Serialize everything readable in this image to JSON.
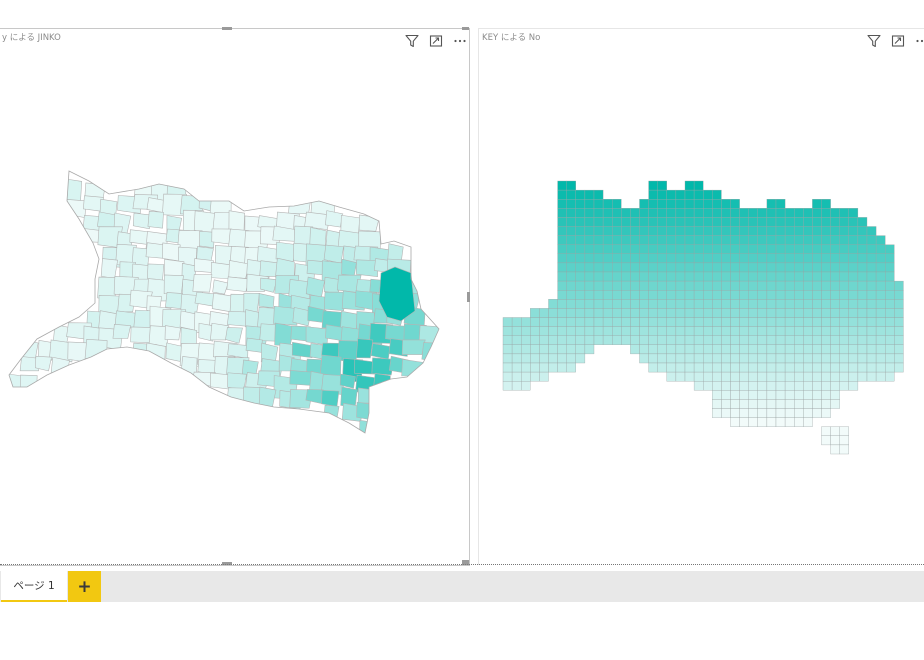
{
  "report": {
    "visuals": [
      {
        "title": "y による JINKO",
        "kind": "filled-map"
      },
      {
        "title": "KEY による No",
        "kind": "grid-map"
      }
    ],
    "visual_header_icons": [
      "filter-icon",
      "focus-mode-icon",
      "more-options-icon"
    ]
  },
  "colors": {
    "accent_dark": "#01b8aa",
    "accent_light": "#f2fbfa",
    "region_border": "#b4b4b4",
    "tab_accent": "#f2c811",
    "tabbar_bg": "#e8e8e8"
  },
  "pages": {
    "tabs": [
      {
        "label": "ページ 1",
        "active": true
      }
    ],
    "add_label": "+"
  }
}
